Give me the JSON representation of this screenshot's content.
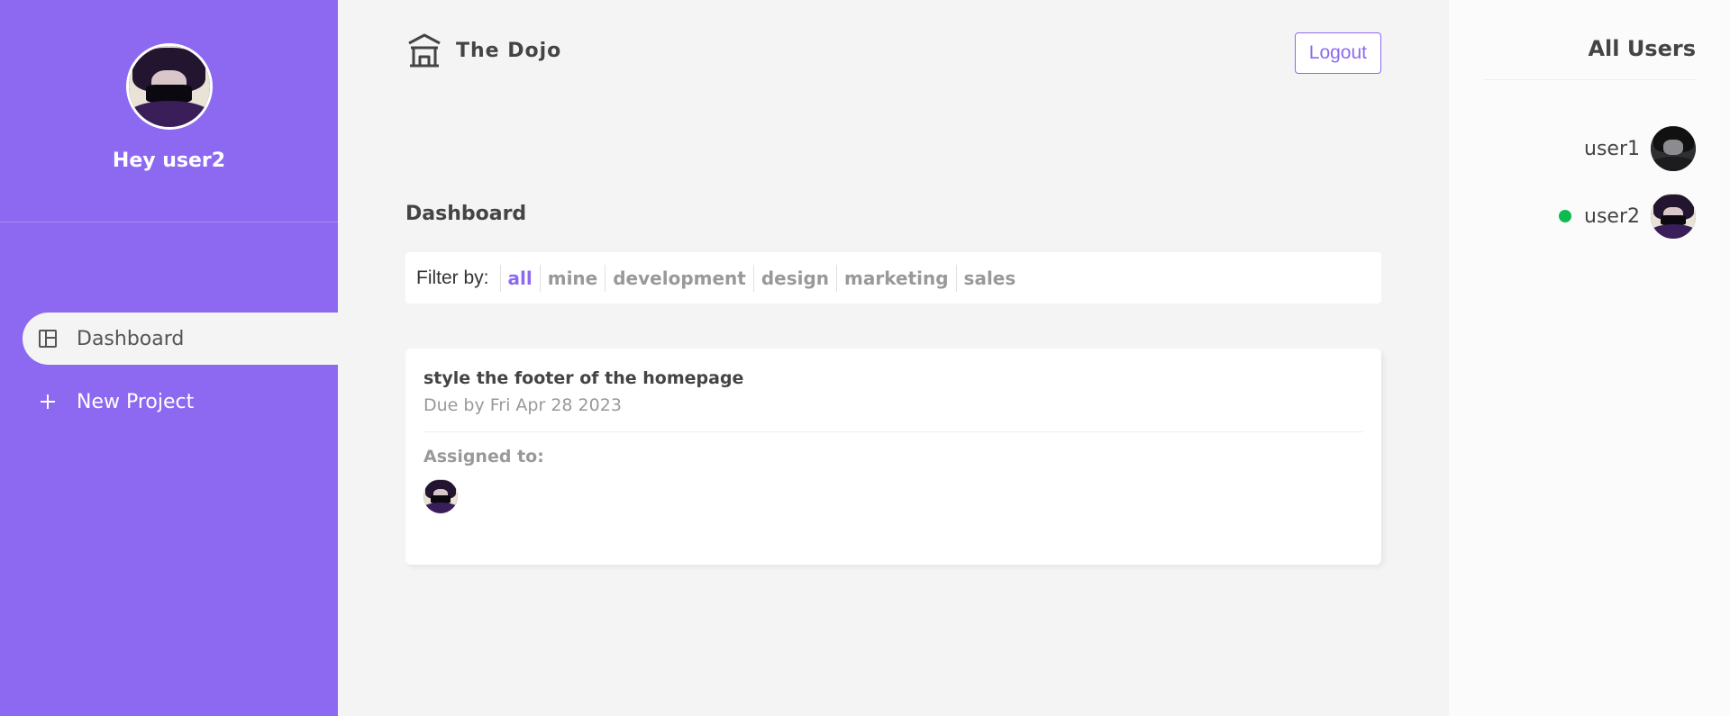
{
  "sidebar": {
    "greeting": "Hey user2",
    "avatar_icon": "user-avatar",
    "nav": [
      {
        "label": "Dashboard",
        "icon": "dashboard-icon",
        "active": true
      },
      {
        "label": "New Project",
        "icon": "plus-icon",
        "active": false
      }
    ],
    "accent_color": "#8d69f1"
  },
  "header": {
    "brand": "The Dojo",
    "brand_icon": "temple-icon",
    "logout_label": "Logout"
  },
  "main": {
    "title": "Dashboard",
    "filter": {
      "label": "Filter by:",
      "options": [
        "all",
        "mine",
        "development",
        "design",
        "marketing",
        "sales"
      ],
      "selected": "all"
    },
    "projects": [
      {
        "name": "style the footer of the homepage",
        "due": "Due by Fri Apr 28 2023",
        "assigned_label": "Assigned to:",
        "assigned_users": [
          "user2"
        ]
      }
    ]
  },
  "users_panel": {
    "title": "All Users",
    "users": [
      {
        "name": "user1",
        "online": false
      },
      {
        "name": "user2",
        "online": true
      }
    ],
    "online_color": "#0ebb50"
  }
}
